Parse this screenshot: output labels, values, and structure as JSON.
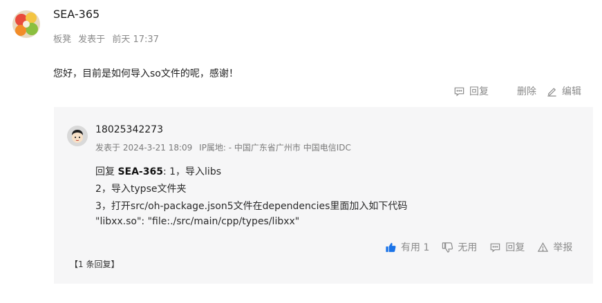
{
  "post": {
    "author": "SEA-365",
    "meta_user": "板凳",
    "meta_action": "发表于",
    "meta_time": "前天 17:37",
    "content": "您好，目前是如何导入so文件的呢，感谢！",
    "actions": {
      "reply": "回复",
      "delete": "删除",
      "edit": "编辑"
    }
  },
  "reply": {
    "author": "18025342273",
    "meta_time": "发表于 2024-3-21 18:09",
    "meta_ip": "IP属地: - 中国广东省广州市 中国电信IDC",
    "line1_prefix": "回复 ",
    "line1_mention": "SEA-365",
    "line1_suffix": ": 1，导入libs",
    "line2": "2，导入typse文件夹",
    "line3": "3，打开src/oh-package.json5文件在dependencies里面加入如下代码",
    "line4": "\"libxx.so\": \"file:./src/main/cpp/types/libxx\"",
    "actions": {
      "like": "有用 1",
      "dislike": "无用",
      "reply": "回复",
      "report": "举报"
    }
  },
  "reply_count_link": "【1 条回复】",
  "colors": {
    "like_blue": "#1a73e8",
    "reply_bg": "#f6f6f7",
    "muted": "#8a8a8a"
  },
  "icons": [
    "comment-icon",
    "edit-icon",
    "thumbs-up-icon",
    "thumbs-down-icon",
    "warning-icon"
  ]
}
